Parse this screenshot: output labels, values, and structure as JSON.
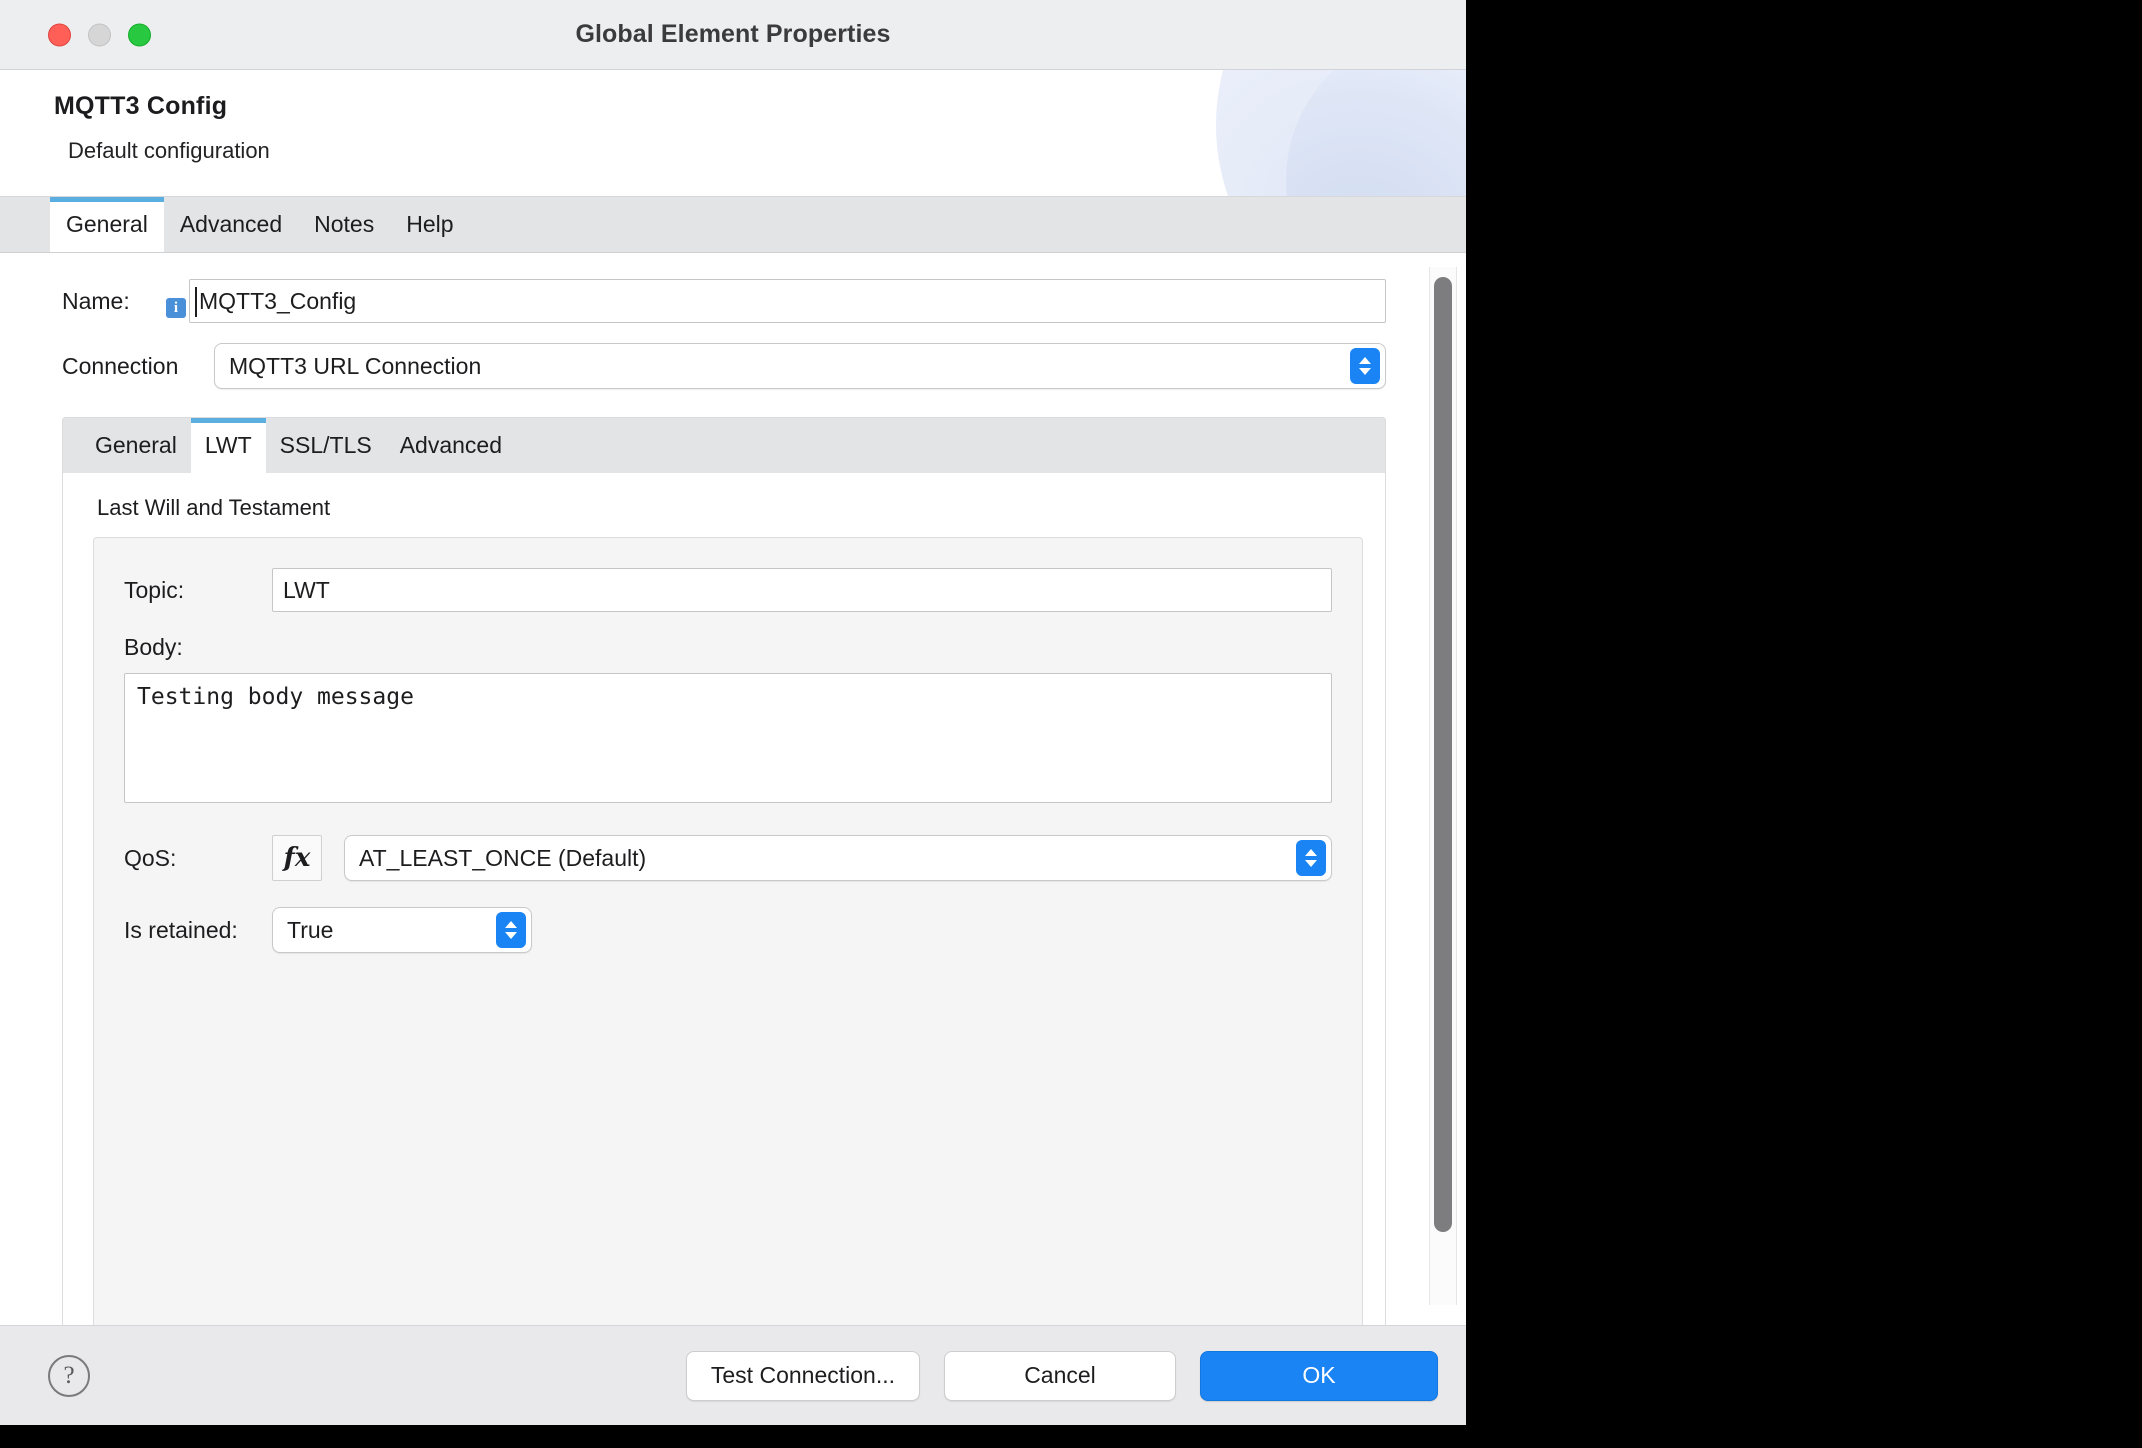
{
  "window": {
    "title": "Global Element Properties",
    "traffic_lights": [
      "close-button",
      "minimize-button",
      "maximize-button"
    ]
  },
  "header": {
    "title": "MQTT3 Config",
    "subtitle": "Default configuration"
  },
  "outer_tabs": [
    {
      "label": "General",
      "active": true
    },
    {
      "label": "Advanced",
      "active": false
    },
    {
      "label": "Notes",
      "active": false
    },
    {
      "label": "Help",
      "active": false
    }
  ],
  "form": {
    "name_label": "Name:",
    "name_value": "MQTT3_Config",
    "name_info_icon": "info-icon",
    "connection_label": "Connection",
    "connection_value": "MQTT3 URL Connection"
  },
  "inner_tabs": [
    {
      "label": "General",
      "active": false
    },
    {
      "label": "LWT",
      "active": true
    },
    {
      "label": "SSL/TLS",
      "active": false
    },
    {
      "label": "Advanced",
      "active": false
    }
  ],
  "lwt": {
    "group_title": "Last Will and Testament",
    "topic_label": "Topic:",
    "topic_value": "LWT",
    "body_label": "Body:",
    "body_value": "Testing body message",
    "qos_label": "QoS:",
    "qos_fx_label": "fx",
    "qos_value": "AT_LEAST_ONCE (Default)",
    "retained_label": "Is retained:",
    "retained_value": "True"
  },
  "footer": {
    "help_glyph": "?",
    "test_connection_label": "Test Connection...",
    "cancel_label": "Cancel",
    "ok_label": "OK"
  },
  "colors": {
    "accent_blue": "#1a84f5",
    "tab_indicator": "#5aaee0",
    "titlebar_bg": "#edeef0",
    "footer_bg": "#e9e9eb"
  }
}
